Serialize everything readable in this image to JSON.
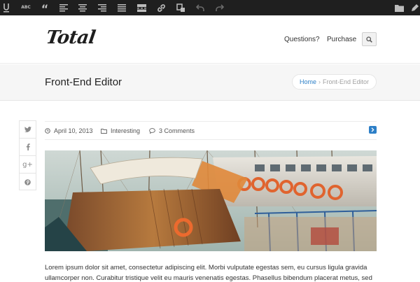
{
  "brand": {
    "logo_text": "Total"
  },
  "nav": {
    "questions": "Questions?",
    "purchase": "Purchase"
  },
  "page": {
    "title": "Front-End Editor"
  },
  "breadcrumb": {
    "home": "Home",
    "separator": "›",
    "current": "Front-End Editor"
  },
  "meta": {
    "date": "April 10, 2013",
    "category": "Interesting",
    "comments": "3 Comments"
  },
  "toolbar": {
    "strike_label": "ABC",
    "quote_label": "“"
  },
  "share": {
    "twitter": "t",
    "facebook": "f",
    "google": "g+",
    "pinterest": "p"
  },
  "content": {
    "paragraph": "Lorem ipsum dolor sit amet, consectetur adipiscing elit. Morbi vulputate egestas sem, eu cursus ligula gravida ullamcorper non. Curabitur tristique velit eu mauris venenatis egestas. Phasellus bibendum placerat metus, sed"
  },
  "colors": {
    "toolbar_bg": "#1f1f1f",
    "accent": "#2c7fc7",
    "titlebar_bg": "#f6f6f6"
  },
  "icons": [
    "underline-icon",
    "strikethrough-icon",
    "blockquote-icon",
    "align-left-icon",
    "align-center-icon",
    "align-right-icon",
    "align-justify-icon",
    "more-tag-icon",
    "link-icon",
    "paste-text-icon",
    "undo-icon",
    "redo-icon",
    "folder-icon",
    "pen-icon",
    "search-icon",
    "twitter-icon",
    "facebook-icon",
    "googleplus-icon",
    "pinterest-icon",
    "clock-icon",
    "category-folder-icon",
    "comment-icon",
    "next-arrow-icon"
  ]
}
